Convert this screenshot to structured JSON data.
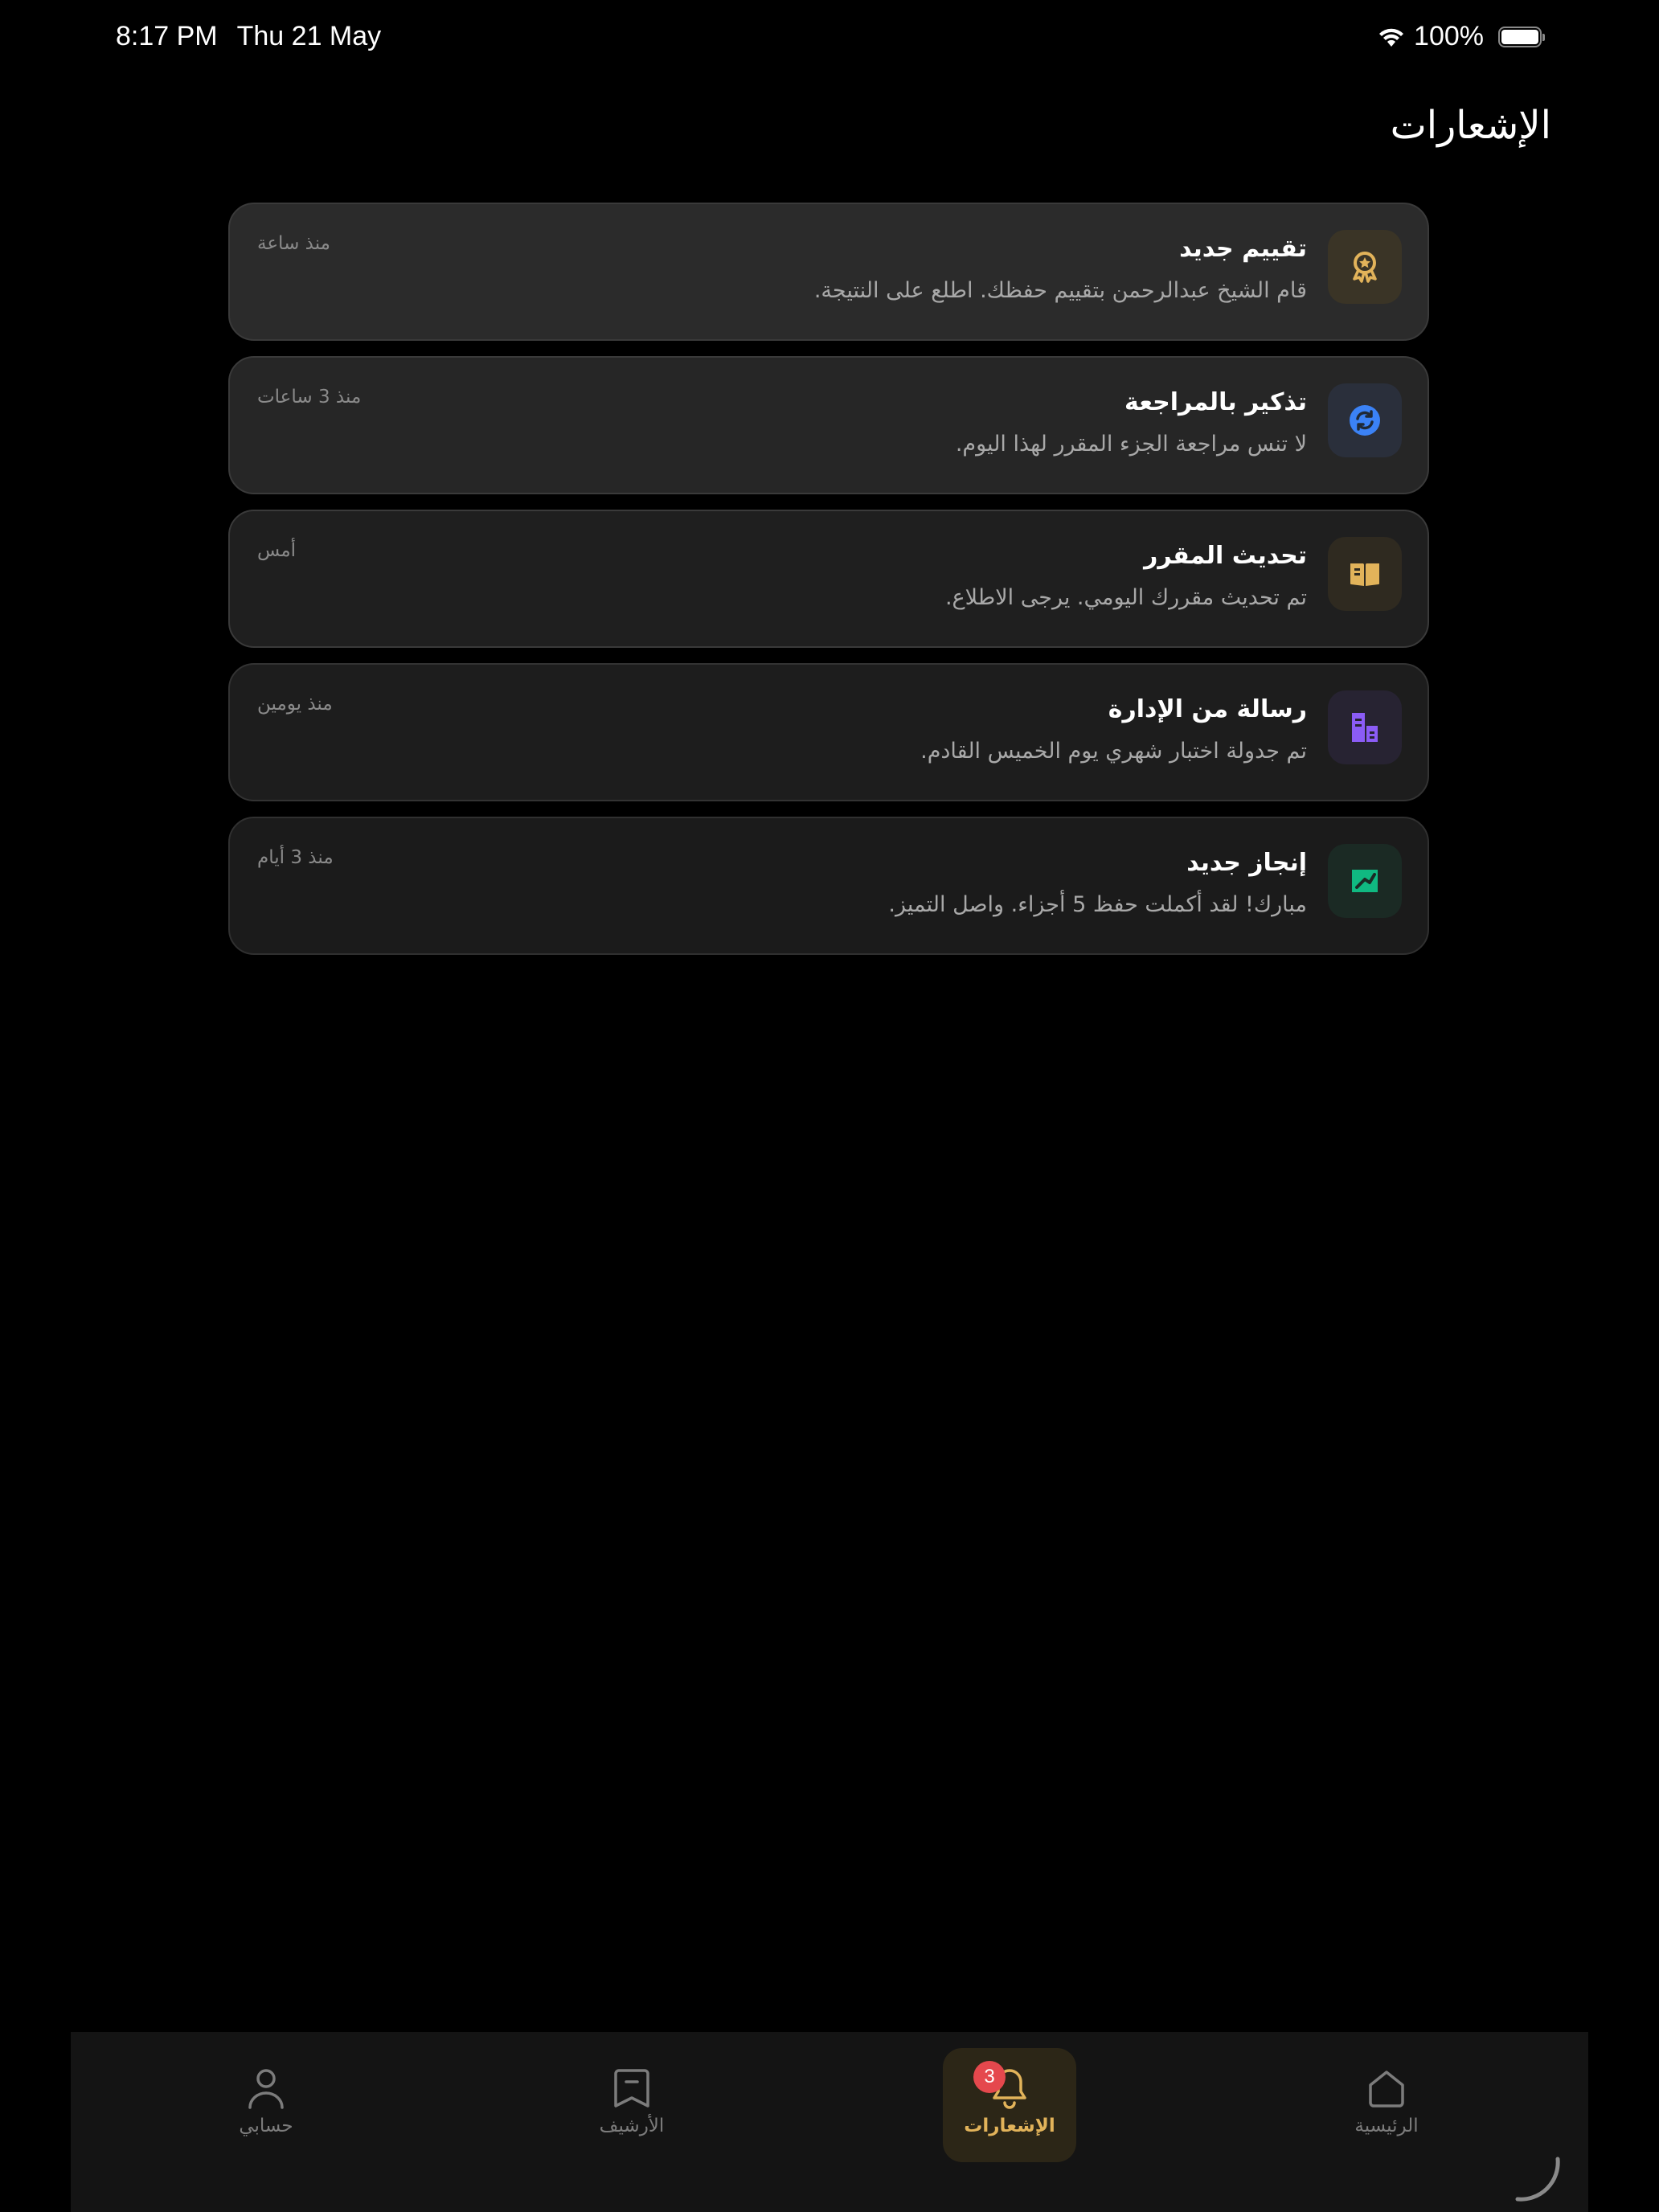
{
  "status_bar": {
    "time": "8:17 PM",
    "date": "Thu 21 May",
    "battery": "100%",
    "icons": [
      "wifi-icon",
      "battery-icon"
    ]
  },
  "header": {
    "title": "الإشعارات"
  },
  "notifications": [
    {
      "title": "تقييم جديد",
      "body": "قام الشيخ عبدالرحمن بتقييم حفظك. اطلع على النتيجة.",
      "time": "منذ ساعة",
      "icon": "award-medal-icon",
      "icon_color": "#e2b35a",
      "icon_bg": "#3a3426"
    },
    {
      "title": "تذكير بالمراجعة",
      "body": "لا تنس مراجعة الجزء المقرر لهذا اليوم.",
      "time": "منذ 3 ساعات",
      "icon": "refresh-icon",
      "icon_color": "#3b82f6",
      "icon_bg": "#2a2f3b"
    },
    {
      "title": "تحديث المقرر",
      "body": "تم تحديث مقررك اليومي. يرجى الاطلاع.",
      "time": "أمس",
      "icon": "open-book-icon",
      "icon_color": "#e2b35a",
      "icon_bg": "#2f2a20"
    },
    {
      "title": "رسالة من الإدارة",
      "body": "تم جدولة اختبار شهري يوم الخميس القادم.",
      "time": "منذ يومين",
      "icon": "admin-building-icon",
      "icon_color": "#8b5cf6",
      "icon_bg": "#272332"
    },
    {
      "title": "إنجاز جديد",
      "body": "مبارك! لقد أكملت حفظ 5 أجزاء. واصل التميز.",
      "time": "منذ 3 أيام",
      "icon": "achievement-icon",
      "icon_color": "#10b981",
      "icon_bg": "#1b2a24"
    }
  ],
  "tabs": [
    {
      "label": "حسابي",
      "icon": "user-icon",
      "active": false
    },
    {
      "label": "الأرشيف",
      "icon": "bookmark-icon",
      "active": false
    },
    {
      "label": "الإشعارات",
      "icon": "bell-icon",
      "active": true,
      "badge": "3"
    },
    {
      "label": "الرئيسية",
      "icon": "home-icon",
      "active": false
    }
  ],
  "colors": {
    "accent": "#e2b35a",
    "badge": "#e5484d",
    "background": "#000000"
  }
}
